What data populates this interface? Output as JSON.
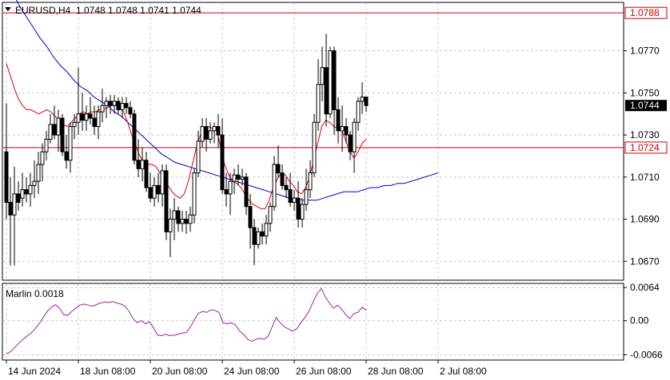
{
  "header": {
    "symbol_timeframe": "EURUSD,H4",
    "ohlc": "1.0748 1.0748 1.0741 1.0744"
  },
  "colors": {
    "background": "#ffffff",
    "grid": "#c8c8c8",
    "axis": "#000000",
    "bull_body": "#ffffff",
    "bear_body": "#000000",
    "candle_outline": "#000000",
    "ma_fast": "#e00000",
    "ma_slow": "#0000cc",
    "level_line": "#cc0000",
    "oscillator": "#a020a0",
    "price_label_bg": "#000000"
  },
  "price_axis": {
    "ticks": [
      "1.0770",
      "1.0750",
      "1.0730",
      "1.0710",
      "1.0690",
      "1.0670"
    ],
    "tick_values": [
      1.077,
      1.075,
      1.073,
      1.071,
      1.069,
      1.067
    ]
  },
  "levels": [
    {
      "label": "1.0788",
      "value": 1.0788,
      "style": "outline"
    },
    {
      "label": "1.0724",
      "value": 1.0724,
      "style": "outline"
    }
  ],
  "current_price": {
    "label": "1.0744",
    "value": 1.0744
  },
  "time_axis": {
    "labels": [
      "14 Jun 2024",
      "18 Jun 08:00",
      "20 Jun 08:00",
      "24 Jun 08:00",
      "26 Jun 08:00",
      "28 Jun 08:00",
      "2 Jul 08:00"
    ],
    "label_bar_index": [
      0,
      18,
      36,
      54,
      72,
      90,
      108
    ]
  },
  "oscillator": {
    "name": "Marlin 0.0018",
    "ticks": [
      "0.0064",
      "0.00",
      "-0.0066"
    ],
    "tick_values": [
      0.0064,
      0.0,
      -0.0066
    ]
  },
  "chart_data": {
    "type": "candlestick",
    "price_range": [
      1.0661,
      1.0793
    ],
    "candles": [
      [
        1.0722,
        1.0745,
        1.069,
        1.0698
      ],
      [
        1.0698,
        1.071,
        1.0668,
        1.0692
      ],
      [
        1.0692,
        1.0715,
        1.0668,
        1.0702
      ],
      [
        1.0702,
        1.0708,
        1.0694,
        1.0698
      ],
      [
        1.07,
        1.0712,
        1.0696,
        1.0704
      ],
      [
        1.0704,
        1.071,
        1.0698,
        1.0702
      ],
      [
        1.0702,
        1.0712,
        1.0696,
        1.0706
      ],
      [
        1.0706,
        1.0718,
        1.07,
        1.0708
      ],
      [
        1.0708,
        1.0722,
        1.0702,
        1.0716
      ],
      [
        1.0716,
        1.0726,
        1.0708,
        1.0722
      ],
      [
        1.0722,
        1.0732,
        1.0718,
        1.0728
      ],
      [
        1.0728,
        1.074,
        1.0726,
        1.0735
      ],
      [
        1.0735,
        1.0744,
        1.0728,
        1.073
      ],
      [
        1.073,
        1.0742,
        1.0722,
        1.0738
      ],
      [
        1.0738,
        1.074,
        1.072,
        1.0722
      ],
      [
        1.0722,
        1.073,
        1.0714,
        1.0718
      ],
      [
        1.0718,
        1.0736,
        1.0712,
        1.0734
      ],
      [
        1.0734,
        1.074,
        1.0728,
        1.0736
      ],
      [
        1.0736,
        1.0762,
        1.073,
        1.074
      ],
      [
        1.074,
        1.075,
        1.0732,
        1.0737
      ],
      [
        1.0737,
        1.0744,
        1.0732,
        1.074
      ],
      [
        1.074,
        1.0748,
        1.0735,
        1.0738
      ],
      [
        1.0738,
        1.0744,
        1.073,
        1.0734
      ],
      [
        1.0734,
        1.0744,
        1.0728,
        1.0741
      ],
      [
        1.0741,
        1.0752,
        1.0736,
        1.0744
      ],
      [
        1.0744,
        1.0748,
        1.0738,
        1.0746
      ],
      [
        1.0746,
        1.0749,
        1.074,
        1.0744
      ],
      [
        1.0744,
        1.0749,
        1.074,
        1.0746
      ],
      [
        1.0746,
        1.0748,
        1.074,
        1.0742
      ],
      [
        1.0742,
        1.0748,
        1.0738,
        1.0745
      ],
      [
        1.0745,
        1.0748,
        1.074,
        1.0743
      ],
      [
        1.0743,
        1.0746,
        1.0738,
        1.074
      ],
      [
        1.074,
        1.0742,
        1.0716,
        1.0718
      ],
      [
        1.0718,
        1.0728,
        1.071,
        1.0714
      ],
      [
        1.0714,
        1.0724,
        1.0708,
        1.0718
      ],
      [
        1.0718,
        1.0722,
        1.0703,
        1.0705
      ],
      [
        1.0705,
        1.0712,
        1.0698,
        1.07
      ],
      [
        1.07,
        1.071,
        1.0696,
        1.0706
      ],
      [
        1.0706,
        1.0712,
        1.0698,
        1.0702
      ],
      [
        1.0702,
        1.0716,
        1.0696,
        1.0713
      ],
      [
        1.0713,
        1.0716,
        1.068,
        1.0684
      ],
      [
        1.0684,
        1.0695,
        1.0672,
        1.069
      ],
      [
        1.069,
        1.07,
        1.068,
        1.0694
      ],
      [
        1.0694,
        1.0696,
        1.0684,
        1.0688
      ],
      [
        1.0688,
        1.0694,
        1.0684,
        1.069
      ],
      [
        1.069,
        1.0694,
        1.0683,
        1.0688
      ],
      [
        1.0688,
        1.0696,
        1.0684,
        1.0692
      ],
      [
        1.0692,
        1.0714,
        1.0688,
        1.0712
      ],
      [
        1.0712,
        1.0732,
        1.071,
        1.0727
      ],
      [
        1.0727,
        1.0738,
        1.0724,
        1.0734
      ],
      [
        1.0734,
        1.0738,
        1.0722,
        1.0728
      ],
      [
        1.0728,
        1.0736,
        1.0726,
        1.0732
      ],
      [
        1.0732,
        1.0736,
        1.0726,
        1.0734
      ],
      [
        1.0734,
        1.074,
        1.0724,
        1.073
      ],
      [
        1.073,
        1.0738,
        1.0702,
        1.0704
      ],
      [
        1.0704,
        1.0712,
        1.0696,
        1.0702
      ],
      [
        1.0702,
        1.0712,
        1.0692,
        1.0708
      ],
      [
        1.0708,
        1.0714,
        1.0702,
        1.0711
      ],
      [
        1.0711,
        1.0716,
        1.0706,
        1.0709
      ],
      [
        1.0709,
        1.0714,
        1.0706,
        1.071
      ],
      [
        1.071,
        1.0712,
        1.0692,
        1.0696
      ],
      [
        1.0696,
        1.0702,
        1.0676,
        1.0686
      ],
      [
        1.0686,
        1.069,
        1.0668,
        1.0678
      ],
      [
        1.0678,
        1.0686,
        1.0676,
        1.0684
      ],
      [
        1.0684,
        1.0688,
        1.0678,
        1.0682
      ],
      [
        1.0682,
        1.0692,
        1.0678,
        1.0688
      ],
      [
        1.0688,
        1.0698,
        1.0684,
        1.0696
      ],
      [
        1.0696,
        1.072,
        1.0694,
        1.0716
      ],
      [
        1.0716,
        1.0725,
        1.071,
        1.0712
      ],
      [
        1.0712,
        1.0716,
        1.0704,
        1.0706
      ],
      [
        1.0706,
        1.071,
        1.07,
        1.0704
      ],
      [
        1.0704,
        1.0712,
        1.0696,
        1.0698
      ],
      [
        1.0698,
        1.0704,
        1.0694,
        1.07
      ],
      [
        1.07,
        1.0708,
        1.0686,
        1.069
      ],
      [
        1.069,
        1.07,
        1.0686,
        1.0697
      ],
      [
        1.0697,
        1.0714,
        1.0694,
        1.0704
      ],
      [
        1.0704,
        1.0718,
        1.07,
        1.0712
      ],
      [
        1.0712,
        1.074,
        1.071,
        1.0736
      ],
      [
        1.0736,
        1.0766,
        1.0732,
        1.0754
      ],
      [
        1.0754,
        1.0772,
        1.0746,
        1.0762
      ],
      [
        1.0762,
        1.0778,
        1.0734,
        1.074
      ],
      [
        1.074,
        1.0772,
        1.0738,
        1.077
      ],
      [
        1.077,
        1.0772,
        1.073,
        1.0742
      ],
      [
        1.0742,
        1.0748,
        1.0726,
        1.0732
      ],
      [
        1.0732,
        1.0744,
        1.0722,
        1.0734
      ],
      [
        1.0734,
        1.0738,
        1.0726,
        1.073
      ],
      [
        1.073,
        1.0732,
        1.0718,
        1.0722
      ],
      [
        1.0722,
        1.0738,
        1.0712,
        1.0736
      ],
      [
        1.0736,
        1.0748,
        1.0732,
        1.0746
      ],
      [
        1.0746,
        1.0755,
        1.074,
        1.0748
      ],
      [
        1.0748,
        1.0748,
        1.0741,
        1.0744
      ]
    ],
    "ma_fast": [
      1.0764,
      1.0758,
      1.0752,
      1.0747,
      1.0744,
      1.0742,
      1.0742,
      1.0741,
      1.074,
      1.0741,
      1.0742,
      1.0741,
      1.0739,
      1.0737,
      1.0735,
      1.0734,
      1.0736,
      1.0738,
      1.074,
      1.0741,
      1.074,
      1.0741,
      1.0741,
      1.0742,
      1.0742,
      1.0743,
      1.0744,
      1.0744,
      1.0743,
      1.0741,
      1.0736,
      1.073,
      1.0725,
      1.072,
      1.0717,
      1.0716,
      1.0716,
      1.0715,
      1.0712,
      1.0709,
      1.0706,
      1.0703,
      1.0701,
      1.07,
      1.0702,
      1.0708,
      1.0716,
      1.0724,
      1.073,
      1.0733,
      1.0734,
      1.0733,
      1.0733,
      1.0724,
      1.0716,
      1.0711,
      1.0708,
      1.0707,
      1.0705,
      1.0702,
      1.0699,
      1.0697,
      1.0696,
      1.0695,
      1.0695,
      1.0699,
      1.0705,
      1.0709,
      1.0712,
      1.0711,
      1.0708,
      1.0706,
      1.0703,
      1.0702,
      1.0705,
      1.071,
      1.0718,
      1.0726,
      1.0734,
      1.0737,
      1.0736,
      1.0734,
      1.0733,
      1.0732,
      1.0727,
      1.0722,
      1.0719,
      1.0722,
      1.0726,
      1.0728
    ],
    "ma_slow": [
      1.0803,
      1.0797,
      1.0791,
      1.0786,
      1.0781,
      1.0776,
      1.0772,
      1.0767,
      1.0763,
      1.076,
      1.0756,
      1.0753,
      1.0751,
      1.0748,
      1.0746,
      1.0744,
      1.0741,
      1.0739,
      1.0736,
      1.0733,
      1.073,
      1.0727,
      1.0724,
      1.0721,
      1.0719,
      1.0717,
      1.0716,
      1.0715,
      1.0714,
      1.0713,
      1.0712,
      1.0711,
      1.071,
      1.0709,
      1.0708,
      1.0707,
      1.0706,
      1.0705,
      1.0704,
      1.0703,
      1.0702,
      1.0701,
      1.07,
      1.07,
      1.0699,
      1.0699,
      1.0699,
      1.07,
      1.0701,
      1.0702,
      1.0703,
      1.0703,
      1.0703,
      1.0704,
      1.0705,
      1.0705,
      1.0706,
      1.0706,
      1.0707,
      1.0707,
      1.0708,
      1.0709,
      1.071,
      1.0711,
      1.0712
    ],
    "ma_slow_start_index": 0,
    "ma_slow_end_index": 108,
    "marlin": [
      -0.0064,
      -0.006,
      -0.0052,
      -0.0044,
      -0.0036,
      -0.003,
      -0.0024,
      -0.0016,
      -0.0006,
      0.0006,
      0.0018,
      0.0026,
      0.0031,
      0.0024,
      0.0012,
      0.001,
      0.0018,
      0.0024,
      0.003,
      0.0032,
      0.003,
      0.0028,
      0.0031,
      0.0034,
      0.0036,
      0.0035,
      0.0037,
      0.0034,
      0.0032,
      0.0028,
      0.0018,
      0.0004,
      -0.0004,
      0.0,
      -0.0006,
      -0.0002,
      -0.0014,
      -0.0028,
      -0.0029,
      -0.0026,
      -0.0029,
      -0.0028,
      -0.0026,
      -0.0024,
      -0.0023,
      -0.0012,
      0.0002,
      0.0014,
      0.0018,
      0.0016,
      0.0021,
      0.002,
      0.0016,
      -0.0004,
      -0.0006,
      -0.0004,
      -0.0008,
      -0.002,
      -0.0026,
      -0.0036,
      -0.004,
      -0.0036,
      -0.0034,
      -0.0036,
      -0.003,
      -0.0012,
      0.0006,
      -0.0004,
      -0.0012,
      -0.0016,
      -0.002,
      -0.0016,
      -0.0004,
      0.0006,
      0.0018,
      0.0036,
      0.0052,
      0.0062,
      0.0046,
      0.0034,
      0.0024,
      0.003,
      0.0022,
      0.0012,
      0.0004,
      0.0014,
      0.0016,
      0.0026,
      0.002
    ],
    "marlin_range": [
      -0.0076,
      0.0072
    ]
  }
}
